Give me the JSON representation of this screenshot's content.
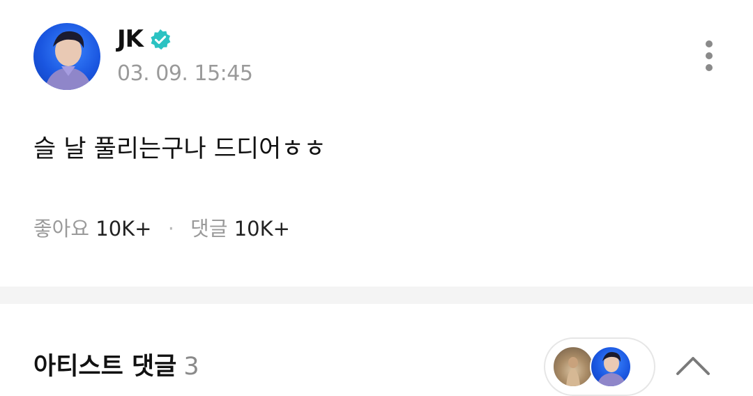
{
  "post": {
    "author": "JK",
    "verified": true,
    "timestamp": "03. 09. 15:45",
    "body": "슬 날 풀리는구나 드디어ㅎㅎ",
    "likes_label": "좋아요",
    "likes_count": "10K+",
    "separator": "·",
    "comments_label": "댓글",
    "comments_count": "10K+"
  },
  "artist_comments": {
    "title": "아티스트 댓글",
    "count": "3"
  },
  "colors": {
    "verified_badge": "#2bc2c2",
    "avatar_blue": "#1a56e0",
    "divider": "#f4f4f4",
    "muted_text": "#9a9a9a"
  },
  "icons": {
    "verified": "verified-badge-icon",
    "more": "more-vertical-icon",
    "collapse": "chevron-up-icon"
  }
}
